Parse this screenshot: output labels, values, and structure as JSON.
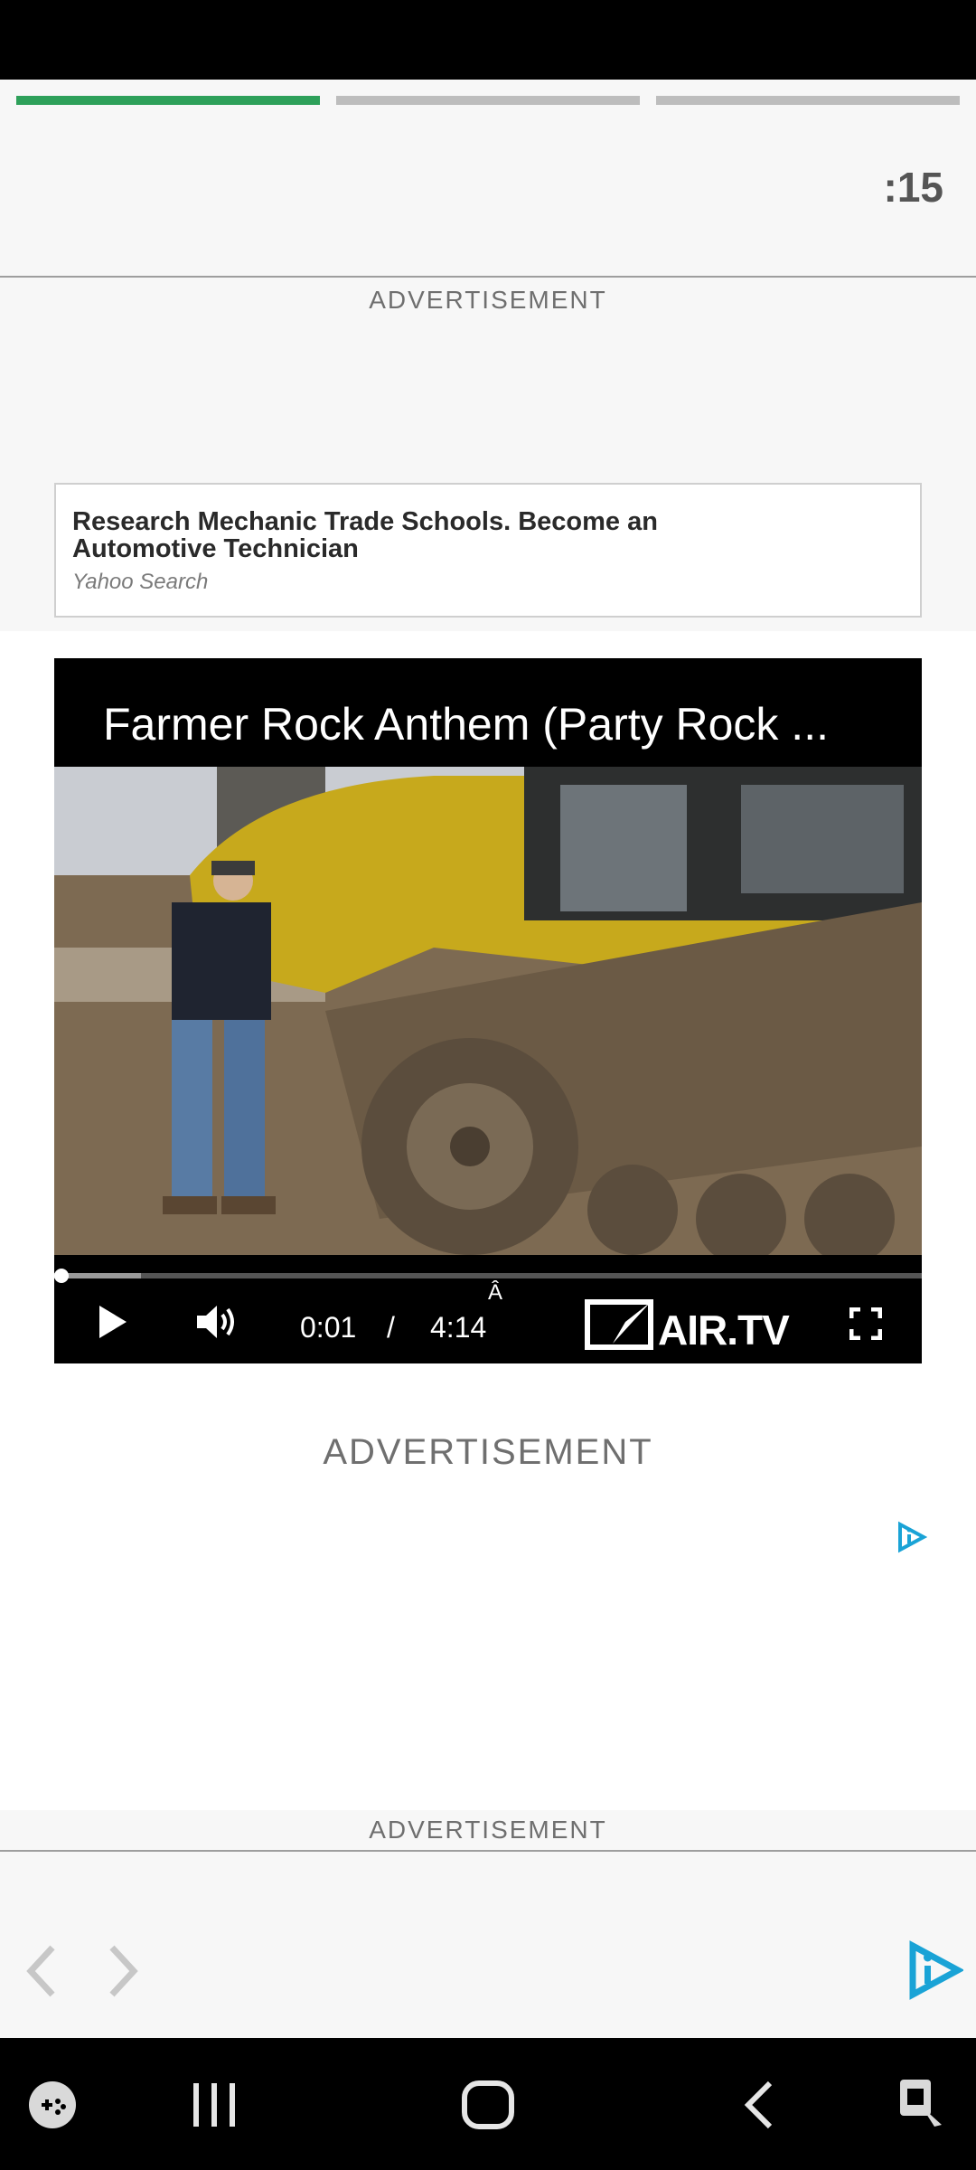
{
  "countdown": ":15",
  "progress": {
    "segments": 3,
    "active_index": 0
  },
  "ad_labels": {
    "top": "ADVERTISEMENT",
    "middle": "ADVERTISEMENT",
    "bottom": "ADVERTISEMENT"
  },
  "ad_card": {
    "headline": "Research Mechanic Trade Schools. Become an Automotive Technician",
    "source": "Yahoo Search"
  },
  "player": {
    "title": "Farmer Rock Anthem (Party Rock ...",
    "current_time": "0:01",
    "separator": "/",
    "duration": "4:14",
    "stray_glyph": "Â",
    "brand": "AIR.TV",
    "progress_fraction": 0.004,
    "buffer_fraction": 0.1
  },
  "icons": {
    "play": "play-icon",
    "volume": "volume-icon",
    "fullscreen": "fullscreen-icon",
    "adchoices": "adchoices-icon",
    "prev": "chevron-left-icon",
    "next": "chevron-right-icon"
  },
  "colors": {
    "accent_green": "#2ea05a",
    "adchoices_blue": "#1aa3d6"
  }
}
